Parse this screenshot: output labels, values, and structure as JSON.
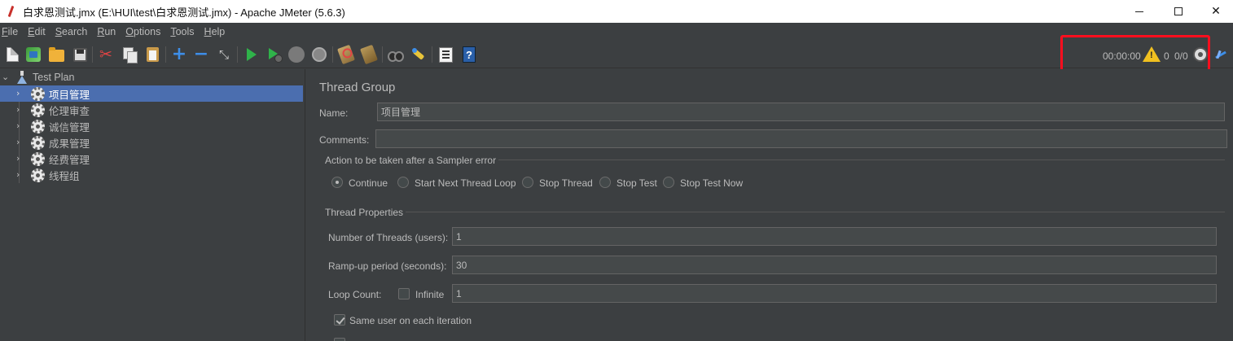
{
  "window": {
    "title": "白求恩测试.jmx (E:\\HUI\\test\\白求恩测试.jmx) - Apache JMeter (5.6.3)",
    "minimize_glyph": "—",
    "close_glyph": "✕"
  },
  "menu": [
    {
      "mnemonic": "F",
      "rest": "ile"
    },
    {
      "mnemonic": "E",
      "rest": "dit"
    },
    {
      "mnemonic": "S",
      "rest": "earch"
    },
    {
      "mnemonic": "R",
      "rest": "un"
    },
    {
      "mnemonic": "O",
      "rest": "ptions"
    },
    {
      "mnemonic": "T",
      "rest": "ools"
    },
    {
      "mnemonic": "H",
      "rest": "elp"
    }
  ],
  "toolbar": {
    "icons": [
      "new-icon",
      "templates-icon",
      "open-icon",
      "save-icon",
      "cut-icon",
      "copy-icon",
      "paste-icon",
      "expand-icon",
      "collapse-icon",
      "toggle-icon",
      "start-icon",
      "start-no-timers-icon",
      "stop-icon",
      "shutdown-icon",
      "clear-icon",
      "clear-all-icon",
      "search-icon",
      "reset-search-icon",
      "function-helper-icon",
      "help-icon"
    ],
    "help_glyph": "?"
  },
  "status": {
    "elapsed_time": "00:00:00",
    "warning_count": "0",
    "active_threads": "0/0",
    "warning_glyph": "!"
  },
  "tree": {
    "root": "Test Plan",
    "items": [
      "项目管理",
      "伦理审查",
      "诚信管理",
      "成果管理",
      "经费管理",
      "线程组"
    ],
    "selected_index": 0
  },
  "thread_group": {
    "heading": "Thread Group",
    "name_label": "Name:",
    "name_value": "项目管理",
    "comments_label": "Comments:",
    "comments_value": "",
    "sampler_error": {
      "title": "Action to be taken after a Sampler error",
      "options": [
        "Continue",
        "Start Next Thread Loop",
        "Stop Thread",
        "Stop Test",
        "Stop Test Now"
      ],
      "selected": "Continue"
    },
    "properties": {
      "title": "Thread Properties",
      "threads_label": "Number of Threads (users):",
      "threads_value": "1",
      "rampup_label": "Ramp-up period (seconds):",
      "rampup_value": "30",
      "loop_label": "Loop Count:",
      "infinite_label": "Infinite",
      "infinite_checked": false,
      "loop_value": "1",
      "same_user_label": "Same user on each iteration",
      "same_user_checked": true
    }
  },
  "colors": {
    "background": "#3c3f41",
    "selection": "#4b6eaf",
    "highlight_box": "#ff0e1e",
    "warning": "#f0c020"
  }
}
